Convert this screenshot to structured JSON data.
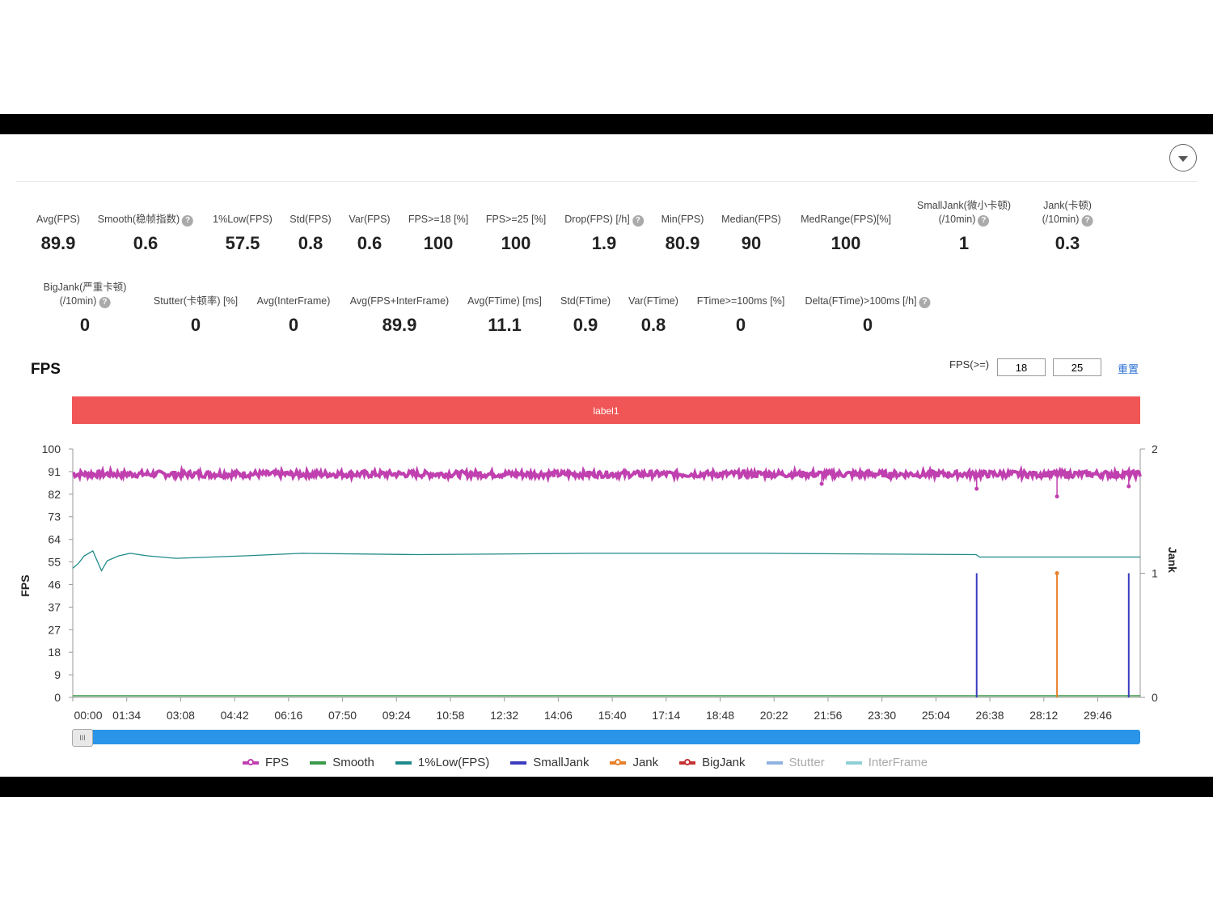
{
  "stats_row1": [
    {
      "label": "Avg(FPS)",
      "value": "89.9",
      "help": false
    },
    {
      "label": "Smooth(稳帧指数)",
      "value": "0.6",
      "help": true
    },
    {
      "label": "1%Low(FPS)",
      "value": "57.5",
      "help": false
    },
    {
      "label": "Std(FPS)",
      "value": "0.8",
      "help": false
    },
    {
      "label": "Var(FPS)",
      "value": "0.6",
      "help": false
    },
    {
      "label": "FPS>=18 [%]",
      "value": "100",
      "help": false
    },
    {
      "label": "FPS>=25 [%]",
      "value": "100",
      "help": false
    },
    {
      "label": "Drop(FPS) [/h]",
      "value": "1.9",
      "help": true
    },
    {
      "label": "Min(FPS)",
      "value": "80.9",
      "help": false
    },
    {
      "label": "Median(FPS)",
      "value": "90",
      "help": false
    },
    {
      "label": "MedRange(FPS)[%]",
      "value": "100",
      "help": false
    },
    {
      "label": "SmallJank(微小卡顿)",
      "label2": "(/10min)",
      "value": "1",
      "help": true
    },
    {
      "label": "Jank(卡顿)",
      "label2": "(/10min)",
      "value": "0.3",
      "help": true
    }
  ],
  "stats_row2": [
    {
      "label": "BigJank(严重卡顿)",
      "label2": "(/10min)",
      "value": "0",
      "help": true
    },
    {
      "label": "Stutter(卡顿率) [%]",
      "value": "0",
      "help": false
    },
    {
      "label": "Avg(InterFrame)",
      "value": "0",
      "help": false
    },
    {
      "label": "Avg(FPS+InterFrame)",
      "value": "89.9",
      "help": false
    },
    {
      "label": "Avg(FTime) [ms]",
      "value": "11.1",
      "help": false
    },
    {
      "label": "Std(FTime)",
      "value": "0.9",
      "help": false
    },
    {
      "label": "Var(FTime)",
      "value": "0.8",
      "help": false
    },
    {
      "label": "FTime>=100ms [%]",
      "value": "0",
      "help": false
    },
    {
      "label": "Delta(FTime)>100ms [/h]",
      "value": "0",
      "help": true
    }
  ],
  "fps_section": {
    "title": "FPS",
    "threshold_label": "FPS(>=)",
    "threshold1": "18",
    "threshold2": "25",
    "reset_label": "重置",
    "band_label": "label1"
  },
  "chart_data": {
    "type": "line",
    "xlabel": "",
    "ylabel": "FPS",
    "y2label": "Jank",
    "x_ticks": [
      "00:00",
      "01:34",
      "03:08",
      "04:42",
      "06:16",
      "07:50",
      "09:24",
      "10:58",
      "12:32",
      "14:06",
      "15:40",
      "17:14",
      "18:48",
      "20:22",
      "21:56",
      "23:30",
      "25:04",
      "26:38",
      "28:12",
      "29:46"
    ],
    "y_ticks": [
      "0",
      "9",
      "18",
      "27",
      "37",
      "46",
      "55",
      "64",
      "73",
      "82",
      "91",
      "100"
    ],
    "y2_ticks": [
      "0",
      "1",
      "2"
    ],
    "ylim": [
      0,
      100
    ],
    "y2lim": [
      0,
      2
    ],
    "xlim_seconds": [
      0,
      1860
    ],
    "fps_base": 89.9,
    "fps_dips": [
      {
        "t": 1305,
        "fps": 86
      },
      {
        "t": 1575,
        "fps": 84
      },
      {
        "t": 1715,
        "fps": 80.9
      },
      {
        "t": 1840,
        "fps": 85
      }
    ],
    "low1_series": {
      "t": [
        0,
        10,
        20,
        35,
        50,
        60,
        80,
        100,
        130,
        180,
        300,
        400,
        600,
        900,
        1200,
        1574,
        1580,
        1860
      ],
      "v": [
        52,
        54,
        57,
        59,
        51,
        55,
        57,
        58,
        57,
        56,
        57,
        58,
        57.5,
        58,
        58,
        57.5,
        56.5,
        56.5
      ]
    },
    "smooth_level": 0.6,
    "small_jank": [
      {
        "t": 1575,
        "v": 1
      },
      {
        "t": 1840,
        "v": 1
      }
    ],
    "jank": [
      {
        "t": 1715,
        "v": 1
      }
    ],
    "colors": {
      "FPS": "#c040b0",
      "Smooth": "#3a9a4a",
      "1%Low(FPS)": "#1f8a8a",
      "SmallJank": "#3b3bbf",
      "Jank": "#e8802a",
      "BigJank": "#c83232",
      "Stutter": "#8fb3e0",
      "InterFrame": "#8fd0d8"
    }
  },
  "legend": [
    "FPS",
    "Smooth",
    "1%Low(FPS)",
    "SmallJank",
    "Jank",
    "BigJank",
    "Stutter",
    "InterFrame"
  ],
  "scrollbar": {
    "handle_glyph": "III"
  }
}
